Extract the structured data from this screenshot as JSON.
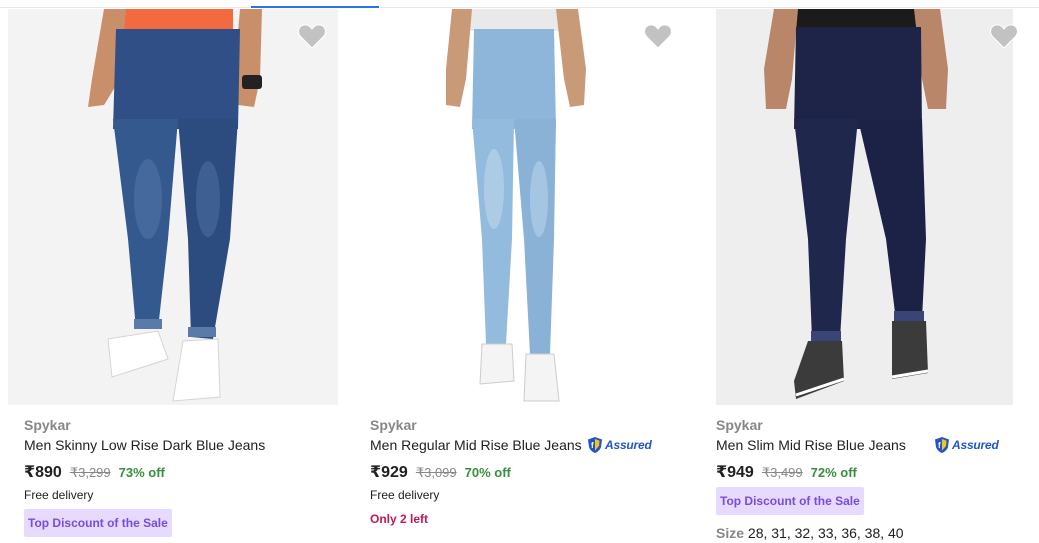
{
  "products": [
    {
      "brand": "Spykar",
      "title": "Men Skinny Low Rise Dark Blue Jeans",
      "price": "₹890",
      "mrp": "₹3,299",
      "discount": "73% off",
      "delivery": "Free delivery",
      "badge": "Top Discount of the Sale",
      "assured": false,
      "wishlist_icon": "heart-icon",
      "image": "jeans-dark-blue-skinny"
    },
    {
      "brand": "Spykar",
      "title": "Men Regular Mid Rise Blue Jeans",
      "price": "₹929",
      "mrp": "₹3,099",
      "discount": "70% off",
      "delivery": "Free delivery",
      "stock": "Only 2 left",
      "assured": true,
      "assured_label": "Assured",
      "wishlist_icon": "heart-icon",
      "image": "jeans-light-blue-regular"
    },
    {
      "brand": "Spykar",
      "title": "Men Slim Mid Rise Blue Jeans",
      "price": "₹949",
      "mrp": "₹3,499",
      "discount": "72% off",
      "badge": "Top Discount of the Sale",
      "assured": true,
      "assured_label": "Assured",
      "size_label": "Size",
      "sizes": "28, 31, 32, 33, 36, 38, 40",
      "wishlist_icon": "heart-icon",
      "image": "jeans-navy-slim"
    }
  ],
  "colors": {
    "accent": "#2874f0",
    "discount_green": "#388e3c",
    "badge_bg": "#e6dbff",
    "badge_text": "#7a4bdc",
    "stock_text": "#c2185b",
    "brand_grey": "#878787"
  }
}
